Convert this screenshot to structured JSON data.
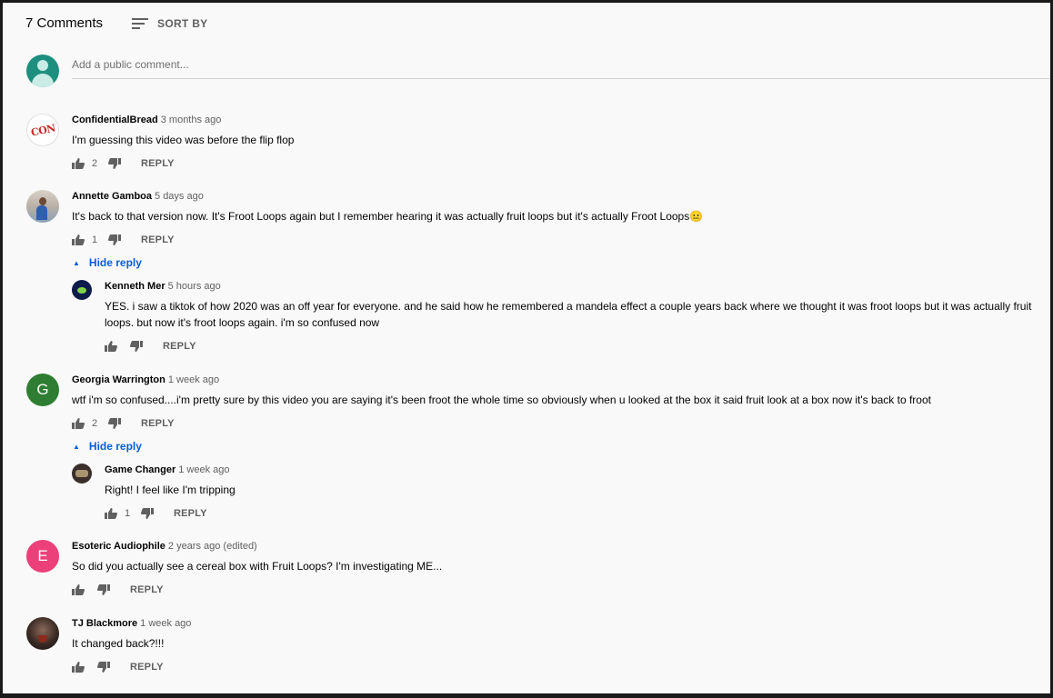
{
  "header": {
    "count": "7 Comments",
    "sort_label": "SORT BY"
  },
  "add_comment": {
    "placeholder": "Add a public comment..."
  },
  "comments": [
    {
      "author": "ConfidentialBread",
      "time": "3 months ago",
      "text": "I'm guessing this video was before the flip flop",
      "likes": "2",
      "reply": "REPLY",
      "avatar_text": "CON"
    },
    {
      "author": "Annette Gamboa",
      "time": "5 days ago",
      "text": "It's back to that version now. It's Froot Loops again but I remember hearing it was actually fruit loops but it's actually Froot Loops😐",
      "likes": "1",
      "reply": "REPLY",
      "hide_reply": "Hide reply",
      "replies": [
        {
          "author": "Kenneth Mer",
          "time": "5 hours ago",
          "text": "YES. i saw a tiktok of how 2020 was an off year for everyone. and he said how he remembered a mandela effect a couple years back where we thought it was froot loops but it was actually fruit loops. but now it's froot loops again. i'm so confused now",
          "likes": "",
          "reply": "REPLY"
        }
      ]
    },
    {
      "author": "Georgia Warrington",
      "time": "1 week ago",
      "text": "wtf i'm so confused....i'm pretty sure by this video you are saying it's been froot the whole time so obviously when u looked at the box it said fruit look at a box now it's back to froot",
      "likes": "2",
      "reply": "REPLY",
      "avatar_text": "G",
      "avatar_color": "#2e7d32",
      "hide_reply": "Hide reply",
      "replies": [
        {
          "author": "Game Changer",
          "time": "1 week ago",
          "text": "Right! I feel like I'm tripping",
          "likes": "1",
          "reply": "REPLY"
        }
      ]
    },
    {
      "author": "Esoteric Audiophile",
      "time": "2 years ago (edited)",
      "text": "So did you actually see a cereal box with Fruit Loops? I'm investigating ME...",
      "likes": "",
      "reply": "REPLY",
      "avatar_text": "E",
      "avatar_color": "#ec407a"
    },
    {
      "author": "TJ Blackmore",
      "time": "1 week ago",
      "text": "It changed back?!!!",
      "likes": "",
      "reply": "REPLY"
    }
  ]
}
